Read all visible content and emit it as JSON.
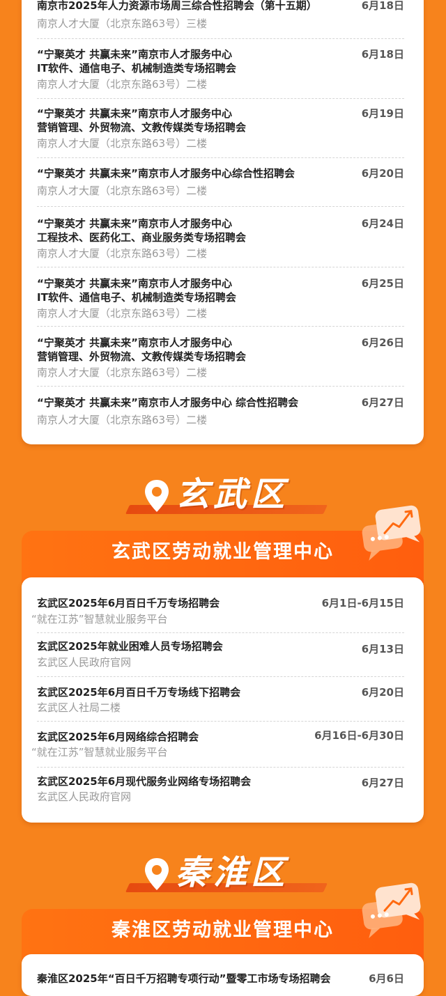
{
  "section_top": {
    "entries": [
      {
        "title": "南京市2025年人力资源市场周三综合性招聘会（第十五期）",
        "date": "6月18日",
        "location": "南京人才大厦（北京东路63号）三楼"
      },
      {
        "title_line1": "“宁聚英才 共赢未来”南京市人才服务中心",
        "title_line2": "IT软件、通信电子、机械制造类专场招聘会",
        "date": "6月18日",
        "location": "南京人才大厦（北京东路63号）二楼"
      },
      {
        "title_line1": "“宁聚英才 共赢未来”南京市人才服务中心",
        "title_line2": "营销管理、外贸物流、文教传媒类专场招聘会",
        "date": "6月19日",
        "location": "南京人才大厦（北京东路63号）二楼"
      },
      {
        "title": "“宁聚英才 共赢未来”南京市人才服务中心综合性招聘会",
        "date": "6月20日",
        "location": "南京人才大厦（北京东路63号）二楼"
      },
      {
        "title_line1": "“宁聚英才 共赢未来”南京市人才服务中心",
        "title_line2": "工程技术、医药化工、商业服务类专场招聘会",
        "date": "6月24日",
        "location": "南京人才大厦（北京东路63号）二楼"
      },
      {
        "title_line1": "“宁聚英才 共赢未来”南京市人才服务中心",
        "title_line2": "IT软件、通信电子、机械制造类专场招聘会",
        "date": "6月25日",
        "location": "南京人才大厦（北京东路63号）二楼"
      },
      {
        "title_line1": "“宁聚英才 共赢未来”南京市人才服务中心",
        "title_line2": "营销管理、外贸物流、文教传媒类专场招聘会",
        "date": "6月26日",
        "location": "南京人才大厦（北京东路63号）二楼"
      },
      {
        "title": "“宁聚英才 共赢未来”南京市人才服务中心 综合性招聘会",
        "date": "6月27日",
        "location": "南京人才大厦（北京东路63号）二楼"
      }
    ]
  },
  "xuanwu": {
    "district_name": "玄武区",
    "banner": "玄武区劳动就业管理中心",
    "entries": [
      {
        "title": "玄武区2025年6月百日千万专场招聘会",
        "date": "6月1日-6月15日",
        "location": "“就在江苏”智慧就业服务平台"
      },
      {
        "title": "玄武区2025年就业困难人员专场招聘会",
        "date": "6月13日",
        "location": "玄武区人民政府官网"
      },
      {
        "title": "玄武区2025年6月百日千万专场线下招聘会",
        "date": "6月20日",
        "location": "玄武区人社局二楼"
      },
      {
        "title": "玄武区2025年6月网络综合招聘会",
        "date": "6月16日-6月30日",
        "location": "“就在江苏”智慧就业服务平台"
      },
      {
        "title": "玄武区2025年6月现代服务业网络专场招聘会",
        "date": "6月27日",
        "location": "玄武区人民政府官网"
      }
    ]
  },
  "qinhuai": {
    "district_name": "秦淮区",
    "banner": "秦淮区劳动就业管理中心",
    "entries": [
      {
        "title": "秦淮区2025年“百日千万招聘专项行动”暨零工市场专场招聘会",
        "date": "6月6日"
      }
    ]
  },
  "icons": {
    "pin": "location-pin-icon",
    "bubble": "chat-chart-bubble-icon"
  },
  "colors": {
    "background": "#F7831C",
    "banner": "#FF6A10",
    "accent_bar": "#E64A0F",
    "card": "#FFFFFF"
  }
}
